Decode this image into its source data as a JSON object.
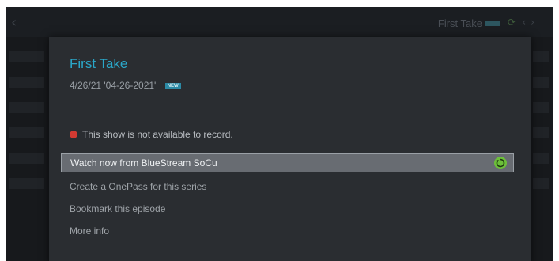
{
  "background": {
    "title": "First Take",
    "back_icon": "back-arrow-icon"
  },
  "dialog": {
    "title": "First Take",
    "subtitle": "4/26/21 '04-26-2021'",
    "new_badge": "NEW",
    "alert_text": "This show is not available to record.",
    "alert_icon": "error-dot-icon",
    "alert_color": "#d23a32",
    "menu": [
      {
        "label": "Watch now from BlueStream SoCu",
        "selected": true,
        "icon": "play-refresh-icon"
      },
      {
        "label": "Create a OnePass for this series",
        "selected": false
      },
      {
        "label": "Bookmark this episode",
        "selected": false
      },
      {
        "label": "More info",
        "selected": false
      }
    ]
  },
  "colors": {
    "accent": "#2aa7c9",
    "selection_bg": "#686c72",
    "dialog_bg": "#2a2d31",
    "play_green": "#6cbf3a"
  }
}
